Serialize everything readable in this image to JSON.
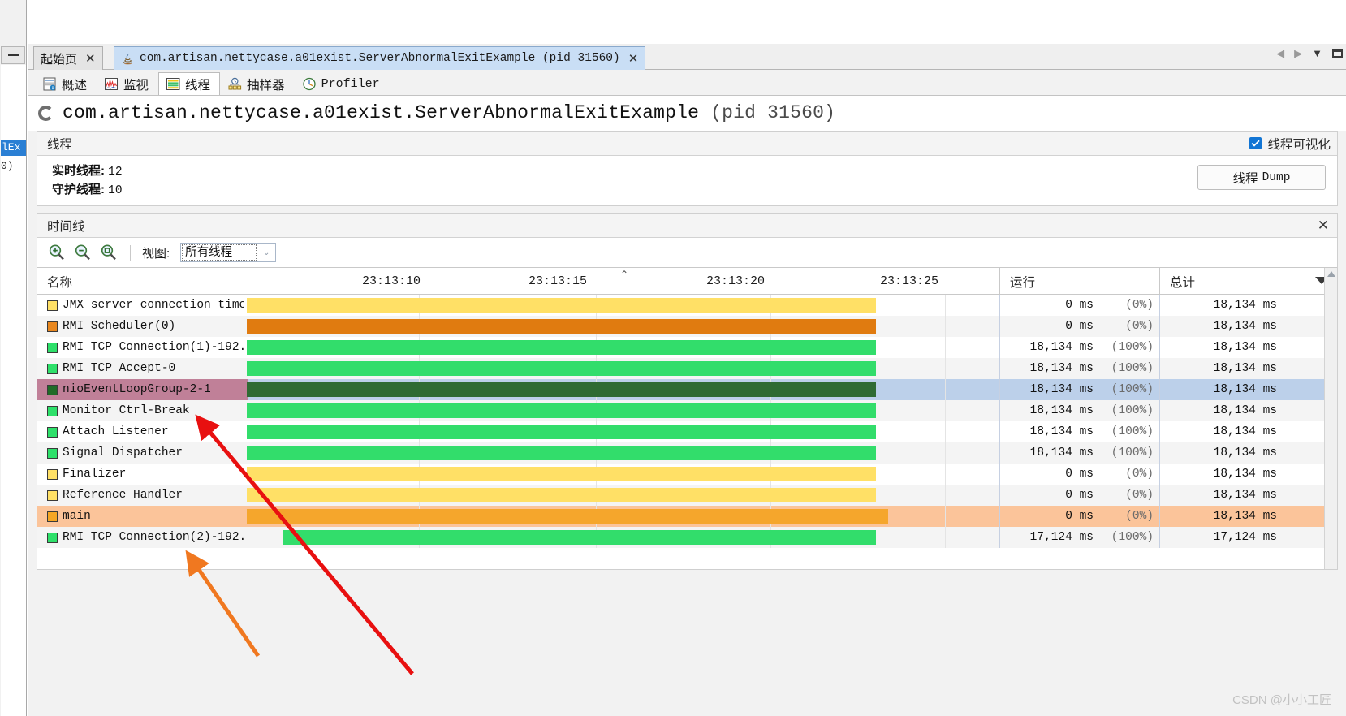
{
  "window": {
    "left_sliver": {
      "minimize_label": "—",
      "selected_text": "lEx",
      "sub_text": "0)"
    }
  },
  "tabs": {
    "items": [
      {
        "label": "起始页",
        "icon": "none",
        "active": false,
        "closable": true
      },
      {
        "label": "com.artisan.nettycase.a01exist.ServerAbnormalExitExample (pid 31560)",
        "icon": "java-icon",
        "active": true,
        "closable": true
      }
    ],
    "nav": {
      "prev": "◀",
      "next": "▶",
      "dropdown": "▼",
      "maximize": "window-icon"
    }
  },
  "view_tabs": [
    {
      "label": "概述",
      "icon": "overview-icon",
      "selected": false
    },
    {
      "label": "监视",
      "icon": "monitor-icon",
      "selected": false
    },
    {
      "label": "线程",
      "icon": "threads-icon",
      "selected": true
    },
    {
      "label": "抽样器",
      "icon": "sampler-icon",
      "selected": false
    },
    {
      "label": "Profiler",
      "icon": "profiler-icon",
      "selected": false
    }
  ],
  "page": {
    "title": "com.artisan.nettycase.a01exist.ServerAbnormalExitExample",
    "pid": "(pid 31560)"
  },
  "threads_section": {
    "title": "线程",
    "visualize_checkbox": {
      "label": "线程可视化",
      "checked": true
    },
    "live_threads_label": "实时线程:",
    "live_threads_value": "12",
    "daemon_threads_label": "守护线程:",
    "daemon_threads_value": "10",
    "dump_button": {
      "label_cn": "线程",
      "label_en": "Dump"
    }
  },
  "timeline_section": {
    "title": "时间线",
    "close_label": "✕",
    "zoom_in_icon": "zoom-in-icon",
    "zoom_out_icon": "zoom-out-icon",
    "zoom_fit_icon": "zoom-fit-icon",
    "view_label": "视图:",
    "view_value": "所有线程",
    "view_caret": "⌄"
  },
  "table": {
    "columns": {
      "name": "名称",
      "running": "运行",
      "total": "总计"
    },
    "time_ticks": [
      "23:13:10",
      "23:13:15",
      "23:13:20",
      "23:13:25"
    ],
    "rows": [
      {
        "name": "JMX server connection time",
        "swatch": "#ffe066",
        "bar_color": "#ffe066",
        "bar_start": 0,
        "bar_end": 775,
        "running_ms": "0 ms",
        "running_pct": "(0%)",
        "total": "18,134 ms",
        "highlight": "none"
      },
      {
        "name": "RMI Scheduler(0)",
        "swatch": "#e8871f",
        "bar_color": "#e07b10",
        "bar_start": 0,
        "bar_end": 775,
        "running_ms": "0 ms",
        "running_pct": "(0%)",
        "total": "18,134 ms",
        "highlight": "none"
      },
      {
        "name": "RMI TCP Connection(1)-192.",
        "swatch": "#2ee06a",
        "bar_color": "#32dd6b",
        "bar_start": 0,
        "bar_end": 775,
        "running_ms": "18,134 ms",
        "running_pct": "(100%)",
        "total": "18,134 ms",
        "highlight": "none"
      },
      {
        "name": "RMI TCP Accept-0",
        "swatch": "#2ee06a",
        "bar_color": "#32dd6b",
        "bar_start": 0,
        "bar_end": 775,
        "running_ms": "18,134 ms",
        "running_pct": "(100%)",
        "total": "18,134 ms",
        "highlight": "none"
      },
      {
        "name": "nioEventLoopGroup-2-1",
        "swatch": "#1f6b27",
        "bar_color": "#2f6b33",
        "bar_start": 0,
        "bar_end": 775,
        "running_ms": "18,134 ms",
        "running_pct": "(100%)",
        "total": "18,134 ms",
        "highlight": "selected"
      },
      {
        "name": "Monitor Ctrl-Break",
        "swatch": "#2ee06a",
        "bar_color": "#32dd6b",
        "bar_start": 0,
        "bar_end": 775,
        "running_ms": "18,134 ms",
        "running_pct": "(100%)",
        "total": "18,134 ms",
        "highlight": "none"
      },
      {
        "name": "Attach Listener",
        "swatch": "#2ee06a",
        "bar_color": "#32dd6b",
        "bar_start": 0,
        "bar_end": 775,
        "running_ms": "18,134 ms",
        "running_pct": "(100%)",
        "total": "18,134 ms",
        "highlight": "none"
      },
      {
        "name": "Signal Dispatcher",
        "swatch": "#2ee06a",
        "bar_color": "#32dd6b",
        "bar_start": 0,
        "bar_end": 775,
        "running_ms": "18,134 ms",
        "running_pct": "(100%)",
        "total": "18,134 ms",
        "highlight": "none"
      },
      {
        "name": "Finalizer",
        "swatch": "#ffe066",
        "bar_color": "#ffe066",
        "bar_start": 0,
        "bar_end": 775,
        "running_ms": "0 ms",
        "running_pct": "(0%)",
        "total": "18,134 ms",
        "highlight": "none"
      },
      {
        "name": "Reference Handler",
        "swatch": "#ffe066",
        "bar_color": "#ffe066",
        "bar_start": 0,
        "bar_end": 775,
        "running_ms": "0 ms",
        "running_pct": "(0%)",
        "total": "18,134 ms",
        "highlight": "none"
      },
      {
        "name": "main",
        "swatch": "#f5a623",
        "bar_color": "#f5a62c",
        "bar_start": 0,
        "bar_end": 790,
        "running_ms": "0 ms",
        "running_pct": "(0%)",
        "total": "18,134 ms",
        "highlight": "orange"
      },
      {
        "name": "RMI TCP Connection(2)-192.",
        "swatch": "#2ee06a",
        "bar_color": "#32dd6b",
        "bar_start": 45,
        "bar_end": 775,
        "running_ms": "17,124 ms",
        "running_pct": "(100%)",
        "total": "17,124 ms",
        "highlight": "none"
      }
    ]
  },
  "watermark": "CSDN @小小工匠",
  "colors": {
    "accent_blue": "#1275d4",
    "selected_row": "#bcd0ea",
    "selected_name_highlight": "#c08098",
    "orange_row": "#fbc49a",
    "running_green": "#32dd6b",
    "running_yellow": "#ffe066",
    "running_orange": "#e07b10"
  }
}
